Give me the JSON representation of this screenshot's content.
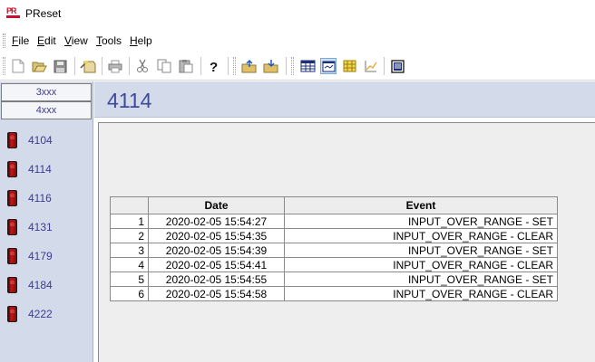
{
  "window": {
    "title": "PReset",
    "logo_text": "PR"
  },
  "menu": [
    {
      "label": "File",
      "mnemonic": "F",
      "rest": "ile"
    },
    {
      "label": "Edit",
      "mnemonic": "E",
      "rest": "dit"
    },
    {
      "label": "View",
      "mnemonic": "V",
      "rest": "iew"
    },
    {
      "label": "Tools",
      "mnemonic": "T",
      "rest": "ools"
    },
    {
      "label": "Help",
      "mnemonic": "H",
      "rest": "elp"
    }
  ],
  "toolbar": {
    "buttons": [
      "new-icon",
      "open-icon",
      "save-icon",
      "wizard-icon",
      "print-icon",
      "cut-icon",
      "copy-icon",
      "paste-icon",
      "help-icon",
      "upload-icon",
      "download-icon",
      "table-view-icon",
      "monitor-view-icon",
      "grid-view-icon",
      "chart-view-icon",
      "log-view-icon"
    ]
  },
  "sidebar": {
    "groups": [
      "3xxx",
      "4xxx"
    ],
    "devices": [
      "4104",
      "4114",
      "4116",
      "4131",
      "4179",
      "4184",
      "4222"
    ]
  },
  "main": {
    "title": "4114",
    "table": {
      "columns": [
        "Date",
        "Event"
      ],
      "rows": [
        {
          "index": "1",
          "date": "2020-02-05 15:54:27",
          "event": "INPUT_OVER_RANGE - SET"
        },
        {
          "index": "2",
          "date": "2020-02-05 15:54:35",
          "event": "INPUT_OVER_RANGE - CLEAR"
        },
        {
          "index": "3",
          "date": "2020-02-05 15:54:39",
          "event": "INPUT_OVER_RANGE - SET"
        },
        {
          "index": "4",
          "date": "2020-02-05 15:54:41",
          "event": "INPUT_OVER_RANGE - CLEAR"
        },
        {
          "index": "5",
          "date": "2020-02-05 15:54:55",
          "event": "INPUT_OVER_RANGE - SET"
        },
        {
          "index": "6",
          "date": "2020-02-05 15:54:58",
          "event": "INPUT_OVER_RANGE - CLEAR"
        }
      ]
    }
  },
  "colors": {
    "accent": "#3e4a9a",
    "panel": "#d3dbea",
    "device_red": "#c41616"
  }
}
